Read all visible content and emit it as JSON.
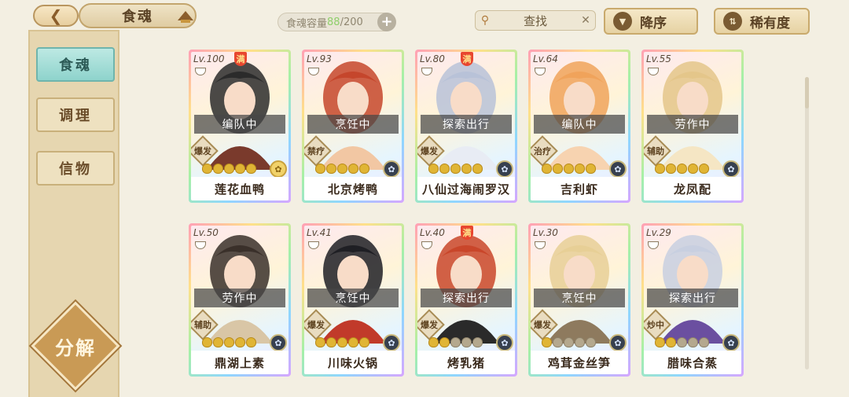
{
  "header": {
    "back_icon": "chevron-left-icon",
    "title": "食魂",
    "capacity_label": "食魂容量",
    "capacity_current": "88",
    "capacity_max": "/200",
    "capacity_plus": "+",
    "search_placeholder": "查找",
    "search_clear": "✕",
    "sort_label": "降序",
    "rarity_label": "稀有度"
  },
  "sidebar": {
    "tabs": [
      {
        "label": "食魂",
        "active": true
      },
      {
        "label": "调理",
        "active": false
      },
      {
        "label": "信物",
        "active": false
      }
    ],
    "decompose_label": "分解"
  },
  "cards": [
    {
      "level": "Lv.100",
      "full": true,
      "full_label": "满",
      "status": "编队中",
      "role": "爆发",
      "stars": 5,
      "element": "gold",
      "name": "莲花血鸭"
    },
    {
      "level": "Lv.93",
      "full": false,
      "status": "烹饪中",
      "role": "禁疗",
      "stars": 5,
      "element": "dark",
      "name": "北京烤鸭"
    },
    {
      "level": "Lv.80",
      "full": true,
      "full_label": "满",
      "status": "探索出行",
      "role": "爆发",
      "stars": 5,
      "element": "dark",
      "name": "八仙过海闹罗汉"
    },
    {
      "level": "Lv.64",
      "full": false,
      "status": "编队中",
      "role": "治疗",
      "stars": 5,
      "element": "dark",
      "name": "吉利虾"
    },
    {
      "level": "Lv.55",
      "full": false,
      "status": "劳作中",
      "role": "辅助",
      "stars": 5,
      "element": "dark",
      "name": "龙凤配"
    },
    {
      "level": "Lv.50",
      "full": false,
      "status": "劳作中",
      "role": "辅助",
      "stars": 5,
      "element": "dark",
      "name": "鼎湖上素"
    },
    {
      "level": "Lv.41",
      "full": false,
      "status": "烹饪中",
      "role": "爆发",
      "stars": 5,
      "element": "dark",
      "name": "川味火锅"
    },
    {
      "level": "Lv.40",
      "full": true,
      "full_label": "满",
      "status": "探索出行",
      "role": "爆发",
      "stars": 2,
      "element": "dark",
      "name": "烤乳猪"
    },
    {
      "level": "Lv.30",
      "full": false,
      "status": "烹饪中",
      "role": "爆发",
      "stars": 1,
      "element": "dark",
      "name": "鸡茸金丝笋"
    },
    {
      "level": "Lv.29",
      "full": false,
      "status": "探索出行",
      "role": "炒中",
      "stars": 2,
      "element": "dark",
      "name": "腊味合蒸"
    }
  ],
  "colors": {
    "background": "#f3efe2",
    "accent_gold": "#e0b535",
    "active_tab": "#8ed3cc"
  }
}
